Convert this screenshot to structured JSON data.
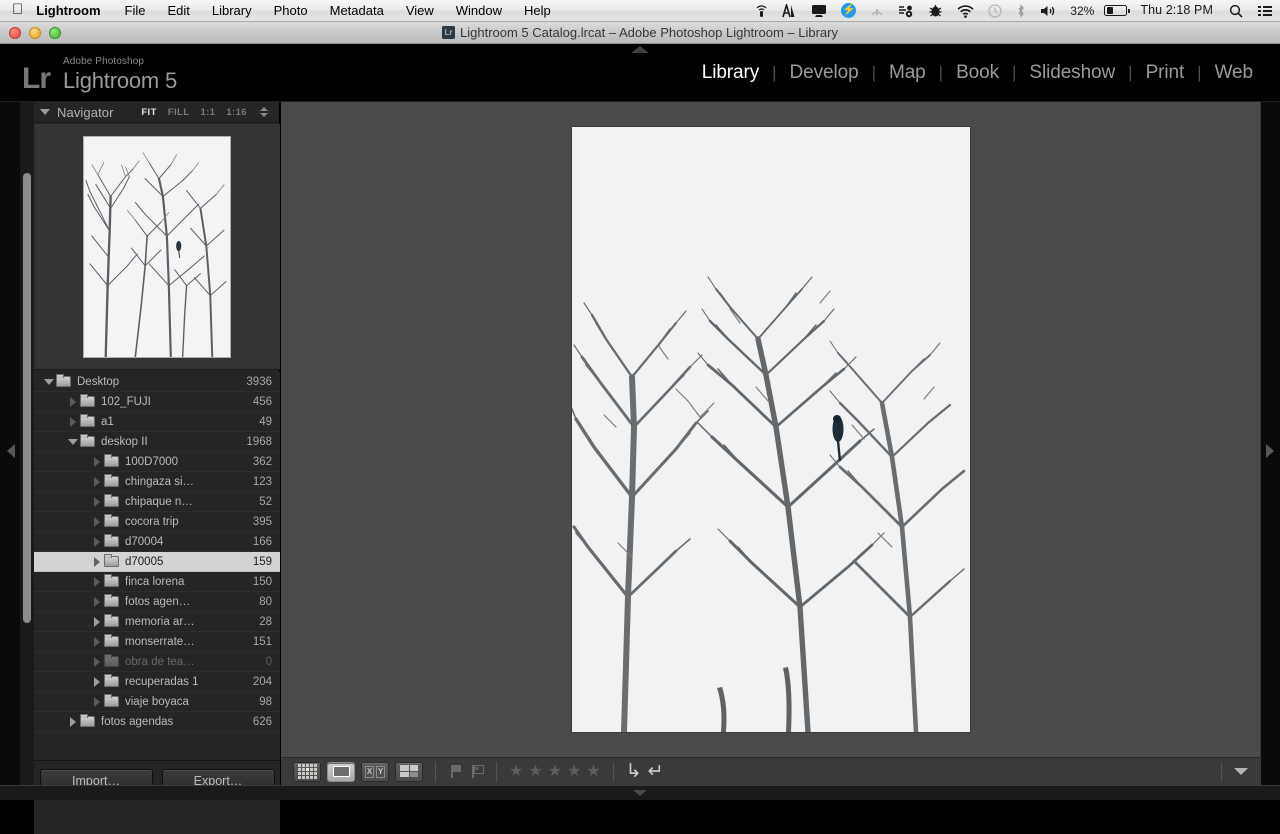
{
  "menubar": {
    "apple_icon": "apple-icon",
    "app_name": "Lightroom",
    "items": [
      "File",
      "Edit",
      "Library",
      "Photo",
      "Metadata",
      "View",
      "Window",
      "Help"
    ],
    "status_icons": [
      "airport-utility-icon",
      "audio-meter-icon",
      "display-icon",
      "flash-icon",
      "vpn-icon",
      "dropbox-sync-icon",
      "bug-icon",
      "wifi-icon",
      "time-machine-icon",
      "bluetooth-icon",
      "volume-icon"
    ],
    "battery_percent": "32%",
    "clock": "Thu 2:18 PM",
    "search_icon": "spotlight-search-icon",
    "notification_icon": "notification-center-icon"
  },
  "titlebar": {
    "title": "Lightroom 5 Catalog.lrcat – Adobe Photoshop Lightroom – Library",
    "close": "close-button",
    "minimize": "minimize-button",
    "zoom": "zoom-button"
  },
  "identity": {
    "mark": "Lr",
    "line1": "Adobe Photoshop",
    "line2": "Lightroom 5"
  },
  "modules": {
    "active": "Library",
    "items": [
      "Library",
      "Develop",
      "Map",
      "Book",
      "Slideshow",
      "Print",
      "Web"
    ]
  },
  "navigator": {
    "title": "Navigator",
    "zoom_levels": [
      "FIT",
      "FILL",
      "1:1",
      "1:16"
    ],
    "active_zoom": "FIT"
  },
  "folders": {
    "rows": [
      {
        "name": "Desktop",
        "count": "3936",
        "indent": 0,
        "disclosure": "down",
        "selected": false,
        "dim": false
      },
      {
        "name": "102_FUJI",
        "count": "456",
        "indent": 1,
        "disclosure": "dots",
        "selected": false,
        "dim": false
      },
      {
        "name": "a1",
        "count": "49",
        "indent": 1,
        "disclosure": "dots",
        "selected": false,
        "dim": false
      },
      {
        "name": "deskop II",
        "count": "1968",
        "indent": 1,
        "disclosure": "down",
        "selected": false,
        "dim": false
      },
      {
        "name": "100D7000",
        "count": "362",
        "indent": 2,
        "disclosure": "dots",
        "selected": false,
        "dim": false
      },
      {
        "name": "chingaza si…",
        "count": "123",
        "indent": 2,
        "disclosure": "dots",
        "selected": false,
        "dim": false
      },
      {
        "name": "chipaque n…",
        "count": "52",
        "indent": 2,
        "disclosure": "dots",
        "selected": false,
        "dim": false
      },
      {
        "name": "cocora trip",
        "count": "395",
        "indent": 2,
        "disclosure": "dots",
        "selected": false,
        "dim": false
      },
      {
        "name": "d70004",
        "count": "166",
        "indent": 2,
        "disclosure": "dots",
        "selected": false,
        "dim": false
      },
      {
        "name": "d70005",
        "count": "159",
        "indent": 2,
        "disclosure": "dots",
        "selected": true,
        "dim": false
      },
      {
        "name": "finca lorena",
        "count": "150",
        "indent": 2,
        "disclosure": "dots",
        "selected": false,
        "dim": false
      },
      {
        "name": "fotos agen…",
        "count": "80",
        "indent": 2,
        "disclosure": "dots",
        "selected": false,
        "dim": false
      },
      {
        "name": "memoria ar…",
        "count": "28",
        "indent": 2,
        "disclosure": "right",
        "selected": false,
        "dim": false
      },
      {
        "name": "monserrate…",
        "count": "151",
        "indent": 2,
        "disclosure": "dots",
        "selected": false,
        "dim": false
      },
      {
        "name": "obra de tea…",
        "count": "0",
        "indent": 2,
        "disclosure": "dots",
        "selected": false,
        "dim": true
      },
      {
        "name": "recuperadas 1",
        "count": "204",
        "indent": 2,
        "disclosure": "right",
        "selected": false,
        "dim": false
      },
      {
        "name": "viaje boyaca",
        "count": "98",
        "indent": 2,
        "disclosure": "dots",
        "selected": false,
        "dim": false
      },
      {
        "name": "fotos agendas",
        "count": "626",
        "indent": 1,
        "disclosure": "right",
        "selected": false,
        "dim": false
      }
    ]
  },
  "panel_buttons": {
    "import": "Import…",
    "export": "Export…"
  },
  "toolbar": {
    "view_modes": [
      "grid-view",
      "loupe-view",
      "compare-view",
      "survey-view"
    ],
    "active_view": "loupe-view",
    "compare_labels": [
      "X",
      "Y"
    ],
    "flags": [
      "flag-pick",
      "flag-reject"
    ],
    "star_count": 5,
    "rotate_right": "rotate-right-icon",
    "rotate_left": "rotate-left-icon",
    "overflow": "toolbar-chevron-down-icon"
  },
  "photo": {
    "subject": "bare tree branches against overcast white sky with perched bird",
    "sky_color": "#f2f3f4",
    "branch_color": "#4a4a4a",
    "bird_color": "#1c2b3a"
  }
}
